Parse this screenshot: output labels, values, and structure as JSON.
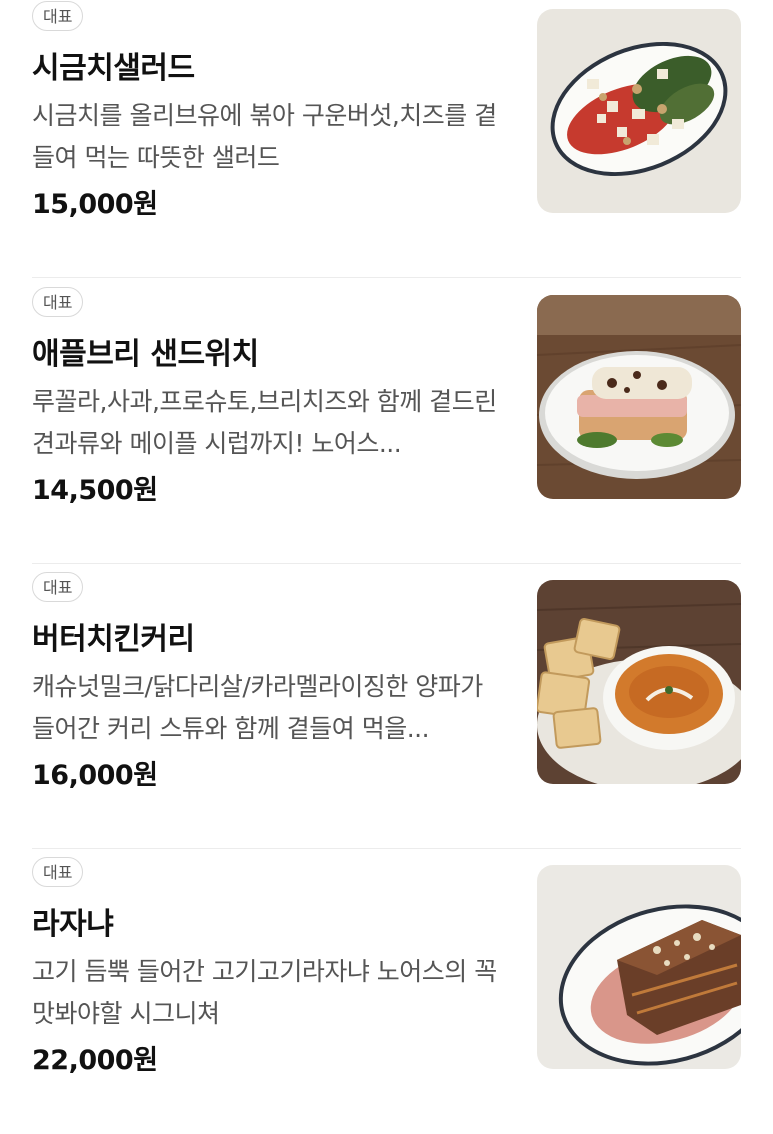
{
  "menu": [
    {
      "badge": "대표",
      "name": "시금치샐러드",
      "description": "시금치를 올리브유에 볶아 구운버섯,치즈를 곁들여 먹는 따뜻한 샐러드",
      "price": "15,000원",
      "image": "spinach-salad-image"
    },
    {
      "badge": "대표",
      "name": "애플브리 샌드위치",
      "description": "루꼴라,사과,프로슈토,브리치즈와 함께 곁드린 견과류와 메이플 시럽까지! 노어스...",
      "price": "14,500원",
      "image": "apple-brie-sandwich-image"
    },
    {
      "badge": "대표",
      "name": "버터치킨커리",
      "description": "캐슈넛밀크/닭다리살/카라멜라이징한 양파가 들어간 커리 스튜와 함께 곁들여 먹을...",
      "price": "16,000원",
      "image": "butter-chicken-curry-image"
    },
    {
      "badge": "대표",
      "name": "라자냐",
      "description": "고기 듬뿍 들어간 고기고기라자냐 노어스의 꼭 맛봐야할 시그니쳐",
      "price": "22,000원",
      "image": "lasagna-image"
    }
  ]
}
